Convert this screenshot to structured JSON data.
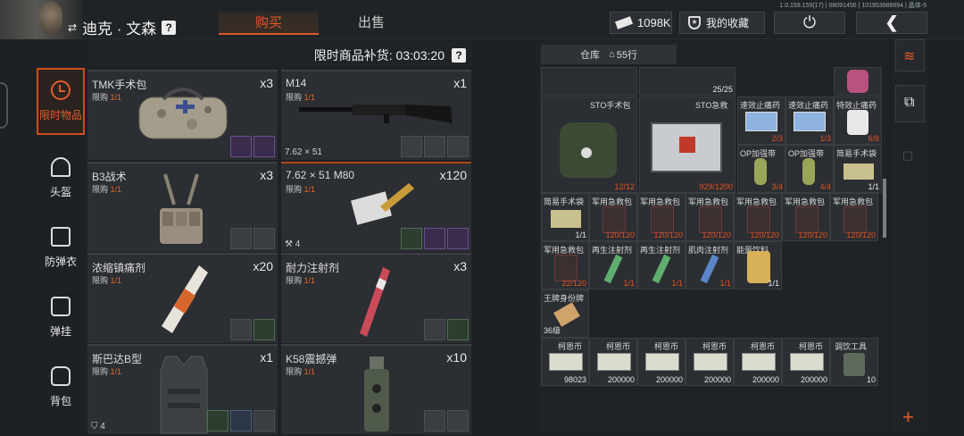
{
  "header": {
    "player_name": "迪克 · 文森",
    "help_icon": "?",
    "tabs": [
      "购买",
      "出售"
    ],
    "active_tab": "购买",
    "version_text": "1.0.159.159(17) | 08091456 | 101953986694 | 晶体-5",
    "money": "1098K",
    "favorites_label": "我的收藏"
  },
  "sidebar": {
    "items": [
      {
        "label": "限时物品",
        "icon": "clock-icon",
        "active": true
      },
      {
        "label": "头盔",
        "icon": "helmet-icon"
      },
      {
        "label": "防弹衣",
        "icon": "vest-icon"
      },
      {
        "label": "弹挂",
        "icon": "chest-rig-icon"
      },
      {
        "label": "背包",
        "icon": "backpack-icon"
      }
    ]
  },
  "shop": {
    "restock_label": "限时商品补货: 03:03:20",
    "limit_prefix": "限购",
    "items": [
      {
        "name": "TMK手术包",
        "limit": "1/1",
        "qty": "x3",
        "foot": ""
      },
      {
        "name": "M14",
        "limit": "1/1",
        "qty": "x1",
        "foot": "7.62 × 51"
      },
      {
        "name": "B3战术",
        "limit": "1/1",
        "qty": "x3",
        "foot": ""
      },
      {
        "name": "7.62 × 51 M80",
        "limit": "1/1",
        "qty": "x120",
        "foot": "4"
      },
      {
        "name": "浓缩镇痛剂",
        "limit": "1/1",
        "qty": "x20",
        "foot": ""
      },
      {
        "name": "耐力注射剂",
        "limit": "1/1",
        "qty": "x3",
        "foot": ""
      },
      {
        "name": "斯巴达B型",
        "limit": "1/1",
        "qty": "x1",
        "foot": "4"
      },
      {
        "name": "K58震撼弹",
        "limit": "1/1",
        "qty": "x10",
        "foot": ""
      }
    ]
  },
  "warehouse": {
    "label": "仓库",
    "rows": "55行",
    "cells": [
      {
        "name": "",
        "count": "25/25",
        "white": true
      },
      {
        "name": "STO手术包",
        "count": "12/12"
      },
      {
        "name": "STO急救",
        "count": "929/1200"
      },
      {
        "name": "速效止痛药",
        "count": "2/3"
      },
      {
        "name": "速效止痛药",
        "count": "1/3"
      },
      {
        "name": "特效止痛药",
        "count": "6/8"
      },
      {
        "name": "OP加强带",
        "count": "3/4"
      },
      {
        "name": "OP加强带",
        "count": "4/4"
      },
      {
        "name": "简易手术袋",
        "count": "1/1"
      },
      {
        "name": "简易手术袋",
        "count": "1/1"
      },
      {
        "name": "军用急救包",
        "count": "120/120"
      },
      {
        "name": "军用急救包",
        "count": "120/120"
      },
      {
        "name": "军用急救包",
        "count": "120/120"
      },
      {
        "name": "军用急救包",
        "count": "120/120"
      },
      {
        "name": "军用急救包",
        "count": "120/120"
      },
      {
        "name": "军用急救包",
        "count": "120/120"
      },
      {
        "name": "军用急救包",
        "count": "22/120"
      },
      {
        "name": "再生注射剂",
        "count": "1/1"
      },
      {
        "name": "再生注射剂",
        "count": "1/1"
      },
      {
        "name": "肌肉注射剂",
        "count": "1/1"
      },
      {
        "name": "能量饮料",
        "count": "1/1"
      },
      {
        "name": "王牌身份牌",
        "count": "36级",
        "white": true
      },
      {
        "name": "柯恩币",
        "count": "98023",
        "white": true
      },
      {
        "name": "柯恩币",
        "count": "200000",
        "white": true
      },
      {
        "name": "柯恩币",
        "count": "200000",
        "white": true
      },
      {
        "name": "柯恩币",
        "count": "200000",
        "white": true
      },
      {
        "name": "柯恩币",
        "count": "200000",
        "white": true
      },
      {
        "name": "柯恩币",
        "count": "200000",
        "white": true
      },
      {
        "name": "调饮工具",
        "count": "10",
        "white": true
      }
    ]
  },
  "right_tools": [
    "layers-icon",
    "sort-icon",
    "empty-slot-icon",
    "add-icon"
  ],
  "colors": {
    "accent": "#e25c2a",
    "panel": "#2b2e32",
    "bg": "#1d2024",
    "count_red": "#e45024"
  }
}
